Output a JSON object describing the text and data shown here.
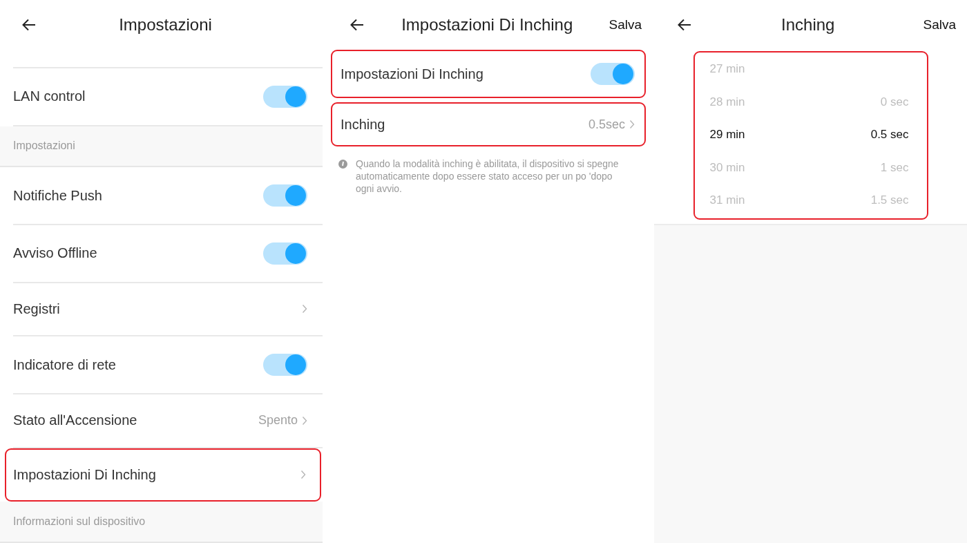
{
  "screens": [
    {
      "header": {
        "title": "Impostazioni"
      },
      "items": [
        {
          "kind": "spacer"
        },
        {
          "kind": "toggle",
          "label": "LAN control",
          "on": true,
          "highlighted": false
        },
        {
          "kind": "section",
          "label": "Impostazioni"
        },
        {
          "kind": "toggle",
          "label": "Notifiche Push",
          "on": true,
          "highlighted": false
        },
        {
          "kind": "toggle",
          "label": "Avviso Offline",
          "on": true,
          "highlighted": false
        },
        {
          "kind": "link",
          "label": "Registri",
          "highlighted": false
        },
        {
          "kind": "toggle",
          "label": "Indicatore di rete",
          "on": true,
          "highlighted": false
        },
        {
          "kind": "link",
          "label": "Stato all'Accensione",
          "value": "Spento",
          "highlighted": false
        },
        {
          "kind": "link",
          "label": "Impostazioni Di Inching",
          "highlighted": true
        },
        {
          "kind": "section",
          "label": "Informazioni sul dispositivo"
        }
      ]
    },
    {
      "header": {
        "title": "Impostazioni Di Inching",
        "action": "Salva"
      },
      "items": [
        {
          "kind": "toggle",
          "label": "Impostazioni Di Inching",
          "on": true,
          "highlighted": true
        },
        {
          "kind": "link",
          "label": "Inching",
          "value": "0.5sec",
          "highlighted": true
        },
        {
          "kind": "note",
          "text": "Quando la modalità inching è abilitata, il dispositivo si spegne automaticamente dopo essere stato acceso per un po 'dopo ogni avvio."
        }
      ]
    },
    {
      "header": {
        "title": "Inching",
        "action": "Salva"
      },
      "picker": {
        "highlighted": true,
        "columns": [
          {
            "items": [
              {
                "label": "27 min",
                "selected": false
              },
              {
                "label": "28 min",
                "selected": false
              },
              {
                "label": "29 min",
                "selected": true
              },
              {
                "label": "30 min",
                "selected": false
              },
              {
                "label": "31 min",
                "selected": false
              }
            ]
          },
          {
            "items": [
              {
                "label": "0 sec",
                "selected": false
              },
              {
                "label": "0.5 sec",
                "selected": true
              },
              {
                "label": "1 sec",
                "selected": false
              },
              {
                "label": "1.5 sec",
                "selected": false
              }
            ]
          }
        ]
      }
    }
  ]
}
